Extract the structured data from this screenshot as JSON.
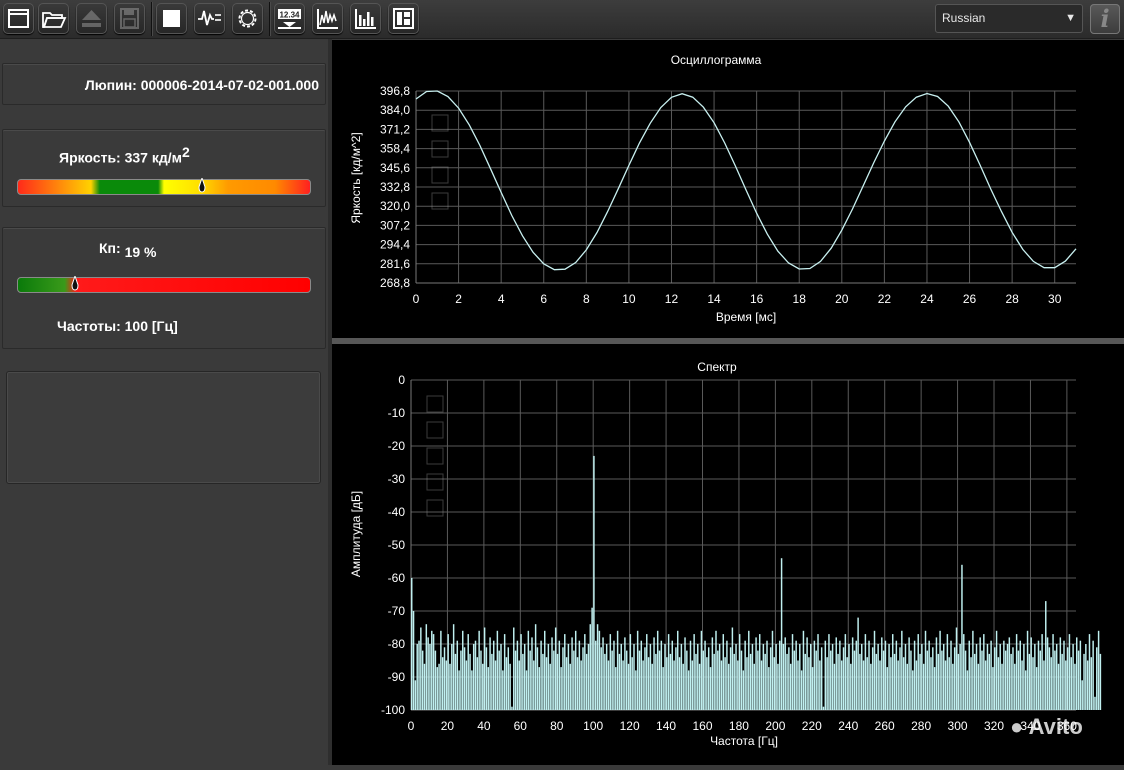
{
  "toolbar": {
    "buttons": [
      {
        "name": "new-window-button",
        "icon": "window-icon"
      },
      {
        "name": "open-button",
        "icon": "folder-open-icon"
      },
      {
        "name": "eject-button",
        "icon": "eject-icon"
      },
      {
        "name": "save-button",
        "icon": "floppy-icon"
      },
      {
        "name": "stop-button",
        "icon": "stop-square-icon"
      },
      {
        "name": "waveform-button",
        "icon": "waveform-icon"
      },
      {
        "name": "settings-button",
        "icon": "gear-icon"
      },
      {
        "name": "counter-button",
        "icon": "counter-icon",
        "label": "12.34"
      },
      {
        "name": "oscillogram-view-button",
        "icon": "waveform-chart-icon"
      },
      {
        "name": "spectrum-view-button",
        "icon": "bar-chart-icon"
      },
      {
        "name": "layout-button",
        "icon": "layout-icon"
      }
    ],
    "language": "Russian",
    "info_label": "i"
  },
  "left": {
    "file_label": "Люпин: 000006-2014-07-02-001.000",
    "brightness_label": "Яркость: 337 кд/м",
    "brightness_sup": "2",
    "brightness_level": 0.63,
    "kp_label": "Кп:",
    "kp_value": "19 %",
    "kp_level": 0.19,
    "freq_label": "Частоты: 100 [Гц]",
    "colors": {
      "gradient_brightness": [
        "#ff1a1a",
        "#ffd400",
        "#0a8a0a",
        "#ffff00",
        "#ff9900",
        "#ff1a1a"
      ],
      "gradient_kp": [
        "#0a8a0a",
        "#ff0000"
      ]
    }
  },
  "oscillogram": {
    "title": "Осциллограмма",
    "xlabel": "Время [мс]",
    "ylabel": "Яркость [кд/м^2]",
    "xticks": [
      "0",
      "2",
      "4",
      "6",
      "8",
      "10",
      "12",
      "14",
      "16",
      "18",
      "20",
      "22",
      "24",
      "26",
      "28",
      "30"
    ],
    "yticks": [
      "396,8",
      "384,0",
      "371,2",
      "358,4",
      "345,6",
      "332,8",
      "320,0",
      "307,2",
      "294,4",
      "281,6",
      "268,8"
    ],
    "line_color": "#c8f0f0"
  },
  "spectrum": {
    "title": "Спектр",
    "xlabel": "Частота [Гц]",
    "ylabel": "Амплитуда [дБ]",
    "xticks": [
      "0",
      "20",
      "40",
      "60",
      "80",
      "100",
      "120",
      "140",
      "160",
      "180",
      "200",
      "220",
      "240",
      "260",
      "280",
      "300",
      "320",
      "340",
      "360"
    ],
    "yticks": [
      "0",
      "-10",
      "-20",
      "-30",
      "-40",
      "-50",
      "-60",
      "-70",
      "-80",
      "-90",
      "-100"
    ],
    "bar_color": "#c0f0f0"
  },
  "chart_data": [
    {
      "type": "line",
      "title": "Осциллограмма",
      "xlabel": "Время [мс]",
      "ylabel": "Яркость [кд/м^2]",
      "xlim": [
        0,
        31
      ],
      "ylim": [
        268.8,
        396.8
      ],
      "series": [
        {
          "x": [
            0,
            0.5,
            1,
            1.5,
            2,
            2.5,
            3,
            3.5,
            4,
            4.5,
            5,
            5.5,
            6,
            6.5,
            7,
            7.5,
            8,
            8.5,
            9,
            9.5,
            10,
            10.5,
            11,
            11.5,
            12,
            12.5,
            13,
            13.5,
            14,
            14.5,
            15,
            15.5,
            16,
            16.5,
            17,
            17.5,
            18,
            18.5,
            19,
            19.5,
            20,
            20.5,
            21,
            21.5,
            22,
            22.5,
            23,
            23.5,
            24,
            24.5,
            25,
            25.5,
            26,
            26.5,
            27,
            27.5,
            28,
            28.5,
            29,
            29.5,
            30,
            30.5,
            31
          ],
          "values": [
            391.5,
            396.5,
            396.8,
            393.1,
            385.4,
            374.3,
            360.5,
            345.0,
            329.1,
            313.8,
            300.3,
            289.3,
            281.6,
            277.7,
            278.0,
            282.5,
            290.9,
            302.5,
            316.4,
            331.7,
            347.2,
            362.2,
            375.3,
            385.8,
            392.6,
            395.0,
            392.7,
            386.0,
            375.6,
            362.1,
            346.8,
            330.9,
            315.4,
            301.4,
            290.0,
            282.1,
            278.1,
            278.5,
            283.2,
            292.0,
            304.0,
            318.1,
            333.5,
            348.9,
            363.5,
            376.3,
            386.3,
            392.7,
            395.1,
            393.1,
            386.7,
            376.2,
            362.6,
            347.2,
            331.4,
            316.4,
            302.6,
            291.2,
            283.2,
            279.0,
            279.0,
            283.4,
            291.6
          ]
        }
      ]
    },
    {
      "type": "bar",
      "title": "Спектр",
      "xlabel": "Частота [Гц]",
      "ylabel": "Амплитуда [дБ]",
      "xlim": [
        0,
        365
      ],
      "ylim": [
        -100,
        0
      ],
      "bar_width_hz": 1,
      "x_start_hz": 0,
      "values": [
        -60,
        -70,
        -91,
        -80,
        -79,
        -75,
        -82,
        -86,
        -74,
        -78,
        -80,
        -76,
        -77,
        -82,
        -87,
        -86,
        -76,
        -84,
        -81,
        -85,
        -77,
        -86,
        -80,
        -74,
        -83,
        -79,
        -88,
        -82,
        -76,
        -81,
        -85,
        -77,
        -83,
        -88,
        -80,
        -79,
        -84,
        -76,
        -82,
        -86,
        -75,
        -81,
        -87,
        -78,
        -83,
        -79,
        -85,
        -76,
        -82,
        -80,
        -88,
        -77,
        -84,
        -81,
        -86,
        -99,
        -75,
        -82,
        -79,
        -85,
        -77,
        -83,
        -80,
        -88,
        -76,
        -82,
        -78,
        -85,
        -74,
        -81,
        -87,
        -79,
        -83,
        -76,
        -84,
        -80,
        -86,
        -78,
        -82,
        -75,
        -83,
        -79,
        -87,
        -81,
        -77,
        -84,
        -80,
        -86,
        -78,
        -82,
        -76,
        -84,
        -79,
        -85,
        -81,
        -77,
        -83,
        -80,
        -74,
        -69,
        -23,
        -79,
        -74,
        -76,
        -81,
        -78,
        -83,
        -80,
        -85,
        -77,
        -82,
        -79,
        -87,
        -76,
        -83,
        -80,
        -85,
        -78,
        -82,
        -86,
        -77,
        -84,
        -80,
        -88,
        -76,
        -82,
        -79,
        -85,
        -81,
        -77,
        -84,
        -80,
        -86,
        -78,
        -83,
        -76,
        -82,
        -79,
        -87,
        -80,
        -84,
        -77,
        -83,
        -79,
        -85,
        -81,
        -76,
        -84,
        -80,
        -86,
        -78,
        -82,
        -88,
        -79,
        -85,
        -77,
        -83,
        -80,
        -86,
        -76,
        -82,
        -79,
        -84,
        -81,
        -87,
        -78,
        -83,
        -76,
        -82,
        -80,
        -85,
        -77,
        -84,
        -79,
        -86,
        -81,
        -75,
        -83,
        -80,
        -85,
        -77,
        -82,
        -88,
        -79,
        -84,
        -76,
        -83,
        -80,
        -86,
        -78,
        -82,
        -77,
        -85,
        -80,
        -83,
        -79,
        -87,
        -81,
        -76,
        -84,
        -80,
        -86,
        -79,
        -54,
        -80,
        -78,
        -83,
        -81,
        -86,
        -77,
        -82,
        -79,
        -85,
        -80,
        -88,
        -76,
        -83,
        -78,
        -84,
        -80,
        -87,
        -79,
        -82,
        -77,
        -85,
        -81,
        -99,
        -79,
        -84,
        -77,
        -82,
        -80,
        -86,
        -78,
        -83,
        -79,
        -85,
        -81,
        -77,
        -84,
        -80,
        -86,
        -78,
        -82,
        -79,
        -72,
        -83,
        -80,
        -85,
        -77,
        -84,
        -79,
        -86,
        -81,
        -76,
        -83,
        -80,
        -85,
        -78,
        -82,
        -79,
        -87,
        -80,
        -84,
        -77,
        -83,
        -79,
        -85,
        -81,
        -76,
        -84,
        -80,
        -86,
        -78,
        -82,
        -88,
        -79,
        -85,
        -77,
        -83,
        -80,
        -86,
        -76,
        -82,
        -79,
        -84,
        -81,
        -87,
        -78,
        -83,
        -76,
        -82,
        -80,
        -85,
        -77,
        -84,
        -79,
        -86,
        -81,
        -75,
        -83,
        -80,
        -56,
        -77,
        -82,
        -88,
        -79,
        -84,
        -76,
        -83,
        -80,
        -86,
        -78,
        -82,
        -77,
        -85,
        -80,
        -83,
        -79,
        -87,
        -81,
        -76,
        -84,
        -80,
        -86,
        -79,
        -82,
        -80,
        -78,
        -83,
        -81,
        -86,
        -77,
        -82,
        -79,
        -85,
        -80,
        -88,
        -76,
        -83,
        -78,
        -84,
        -80,
        -87,
        -79,
        -82,
        -77,
        -85,
        -67,
        -78,
        -81,
        -84,
        -77,
        -82,
        -80,
        -86,
        -78,
        -83,
        -79,
        -85,
        -81,
        -77,
        -84,
        -80,
        -86,
        -78,
        -82,
        -79,
        -91,
        -83,
        -80,
        -85,
        -77,
        -84,
        -79,
        -96,
        -81,
        -76,
        -83
      ]
    }
  ]
}
